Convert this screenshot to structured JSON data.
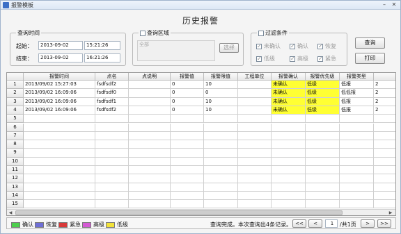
{
  "window": {
    "title": "报警模板"
  },
  "page_title": "历史报警",
  "query_time": {
    "legend": "查询时间",
    "start_label": "起始：",
    "start_date": "2013-09-02",
    "start_time": "15:21:26",
    "end_label": "结束：",
    "end_date": "2013-09-02",
    "end_time": "16:21:26"
  },
  "query_area": {
    "legend": "查询区域",
    "value": "全部",
    "select_label": "选择"
  },
  "filter": {
    "legend": "过滤条件",
    "options": [
      "未确认",
      "确认",
      "恢复",
      "低级",
      "高级",
      "紧急"
    ]
  },
  "buttons": {
    "query": "查询",
    "print": "打印"
  },
  "table": {
    "columns": [
      "",
      "报警时间",
      "点名",
      "点说明",
      "报警值",
      "报警限值",
      "工程单位",
      "报警确认",
      "报警优先级",
      "报警类型",
      ""
    ],
    "rows": [
      [
        "1",
        "2013/09/02 15:27:03",
        "fsdfsdf2",
        "",
        "0",
        "10",
        "",
        "未确认",
        "低级",
        "低报",
        "2"
      ],
      [
        "2",
        "2013/09/02 16:09:06",
        "fsdfsdf0",
        "",
        "0",
        "0",
        "",
        "未确认",
        "低级",
        "低低报",
        "2"
      ],
      [
        "3",
        "2013/09/02 16:09:06",
        "fsdfsdf1",
        "",
        "0",
        "10",
        "",
        "未确认",
        "低级",
        "低报",
        "2"
      ],
      [
        "4",
        "2013/09/02 16:09:06",
        "fsdfsdf2",
        "",
        "0",
        "10",
        "",
        "未确认",
        "低级",
        "低报",
        "2"
      ],
      [
        "5",
        "",
        "",
        "",
        "",
        "",
        "",
        "",
        "",
        "",
        ""
      ],
      [
        "6",
        "",
        "",
        "",
        "",
        "",
        "",
        "",
        "",
        "",
        ""
      ],
      [
        "7",
        "",
        "",
        "",
        "",
        "",
        "",
        "",
        "",
        "",
        ""
      ],
      [
        "8",
        "",
        "",
        "",
        "",
        "",
        "",
        "",
        "",
        "",
        ""
      ],
      [
        "9",
        "",
        "",
        "",
        "",
        "",
        "",
        "",
        "",
        "",
        ""
      ],
      [
        "10",
        "",
        "",
        "",
        "",
        "",
        "",
        "",
        "",
        "",
        ""
      ],
      [
        "11",
        "",
        "",
        "",
        "",
        "",
        "",
        "",
        "",
        "",
        ""
      ],
      [
        "12",
        "",
        "",
        "",
        "",
        "",
        "",
        "",
        "",
        "",
        ""
      ],
      [
        "13",
        "",
        "",
        "",
        "",
        "",
        "",
        "",
        "",
        "",
        ""
      ],
      [
        "14",
        "",
        "",
        "",
        "",
        "",
        "",
        "",
        "",
        "",
        ""
      ],
      [
        "15",
        "",
        "",
        "",
        "",
        "",
        "",
        "",
        "",
        "",
        ""
      ]
    ],
    "highlight_color": "#ffff33"
  },
  "status_legend": [
    {
      "label": "确认",
      "color": "#4ccf4c"
    },
    {
      "label": "恢复",
      "color": "#6f6fd6"
    },
    {
      "label": "紧急",
      "color": "#d93a3a"
    },
    {
      "label": "高级",
      "color": "#d45ad4"
    },
    {
      "label": "低级",
      "color": "#f2e23a"
    }
  ],
  "status_message": "查询完成。本次查询出4条记录。",
  "pagination": {
    "first": "<<",
    "prev": "<",
    "page": "1",
    "total": "/共1页",
    "next": ">",
    "last": ">>"
  }
}
